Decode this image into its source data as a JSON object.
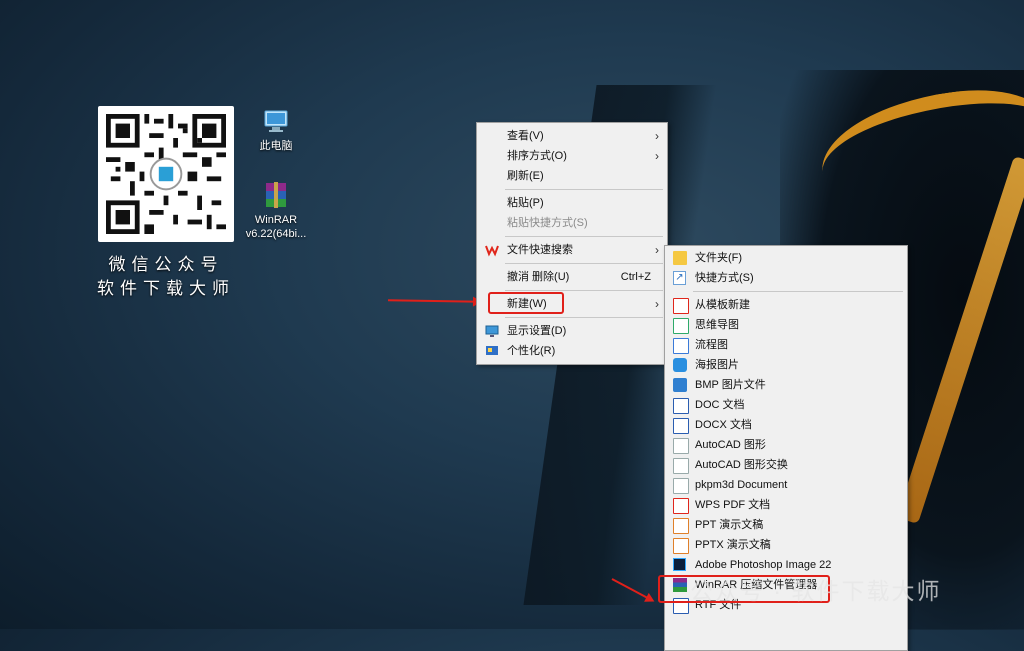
{
  "desktop": {
    "qr_caption_line1": "微信公众号",
    "qr_caption_line2": "软件下载大师",
    "icons": [
      {
        "label": "此电脑"
      },
      {
        "label": "WinRAR",
        "label2": "v6.22(64bi..."
      }
    ]
  },
  "context_menu": {
    "items": [
      {
        "label": "查看(V)"
      },
      {
        "label": "排序方式(O)"
      },
      {
        "label": "刷新(E)"
      },
      {
        "label": "粘贴(P)"
      },
      {
        "label": "粘贴快捷方式(S)"
      },
      {
        "label": "文件快速搜索"
      },
      {
        "label": "撤消 删除(U)",
        "shortcut": "Ctrl+Z"
      },
      {
        "label": "新建(W)"
      },
      {
        "label": "显示设置(D)"
      },
      {
        "label": "个性化(R)"
      }
    ]
  },
  "new_submenu": {
    "items": [
      {
        "label": "文件夹(F)"
      },
      {
        "label": "快捷方式(S)"
      },
      {
        "label": "从模板新建"
      },
      {
        "label": "思维导图"
      },
      {
        "label": "流程图"
      },
      {
        "label": "海报图片"
      },
      {
        "label": "BMP 图片文件"
      },
      {
        "label": "DOC 文档"
      },
      {
        "label": "DOCX 文档"
      },
      {
        "label": "AutoCAD 图形"
      },
      {
        "label": "AutoCAD 图形交换"
      },
      {
        "label": "pkpm3d Document"
      },
      {
        "label": "WPS PDF 文档"
      },
      {
        "label": "PPT 演示文稿"
      },
      {
        "label": "PPTX 演示文稿"
      },
      {
        "label": "Adobe Photoshop Image 22"
      },
      {
        "label": "WinRAR 压缩文件管理器"
      },
      {
        "label": "RTF 文件"
      }
    ]
  },
  "watermark": "公众号 · 软件下载大师",
  "colors": {
    "highlight_red": "#e0201a",
    "menu_bg": "#f0f0f0",
    "accent_orange": "#e69a1e"
  }
}
